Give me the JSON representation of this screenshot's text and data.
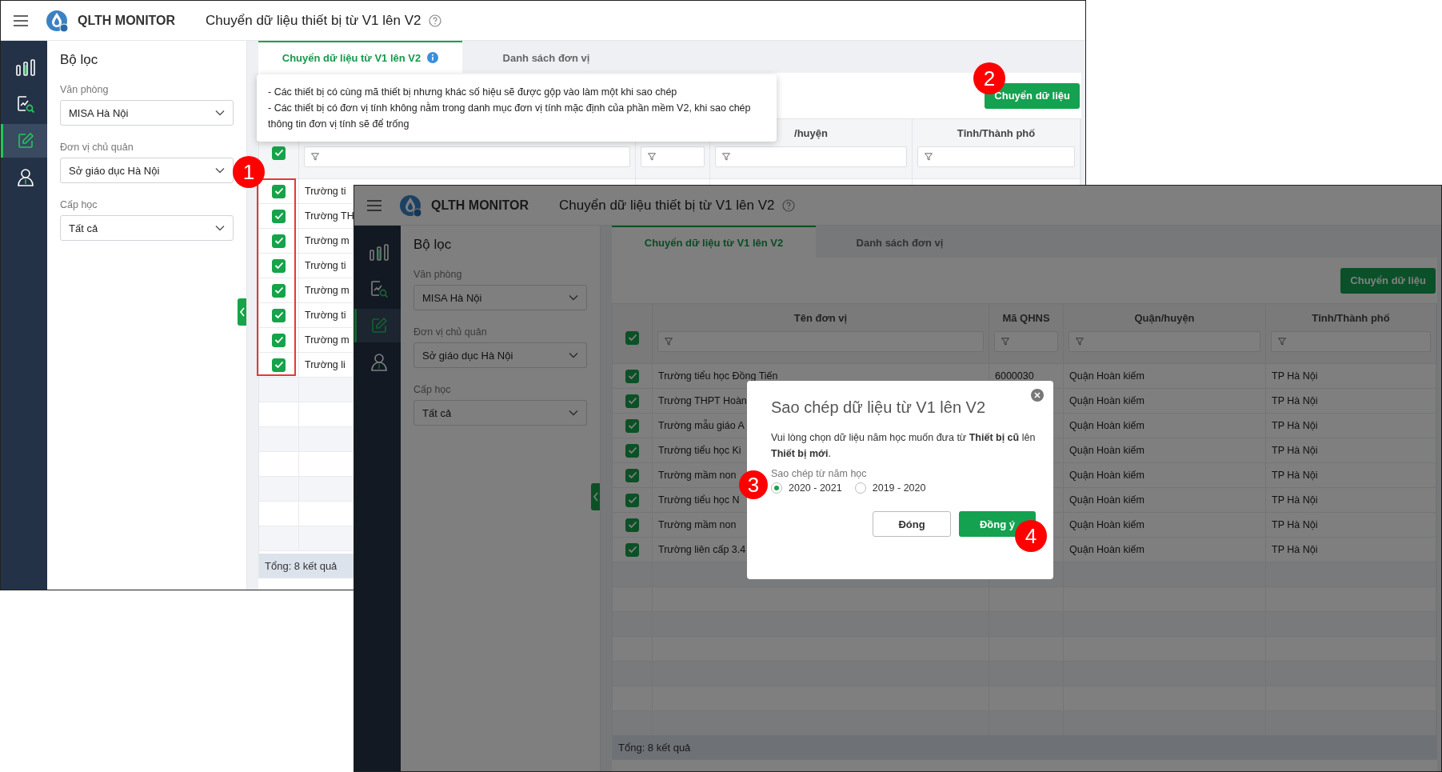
{
  "windows": [
    {
      "kind": "plain",
      "app_name": "QLTH MONITOR",
      "page_title": "Chuyển dữ liệu thiết bị từ V1 lên V2",
      "nav": [
        {
          "kind": "bars",
          "selected": false
        },
        {
          "kind": "report",
          "selected": false
        },
        {
          "kind": "edit",
          "selected": true
        },
        {
          "kind": "user",
          "selected": false
        }
      ],
      "filter": {
        "title": "Bộ lọc",
        "fields": [
          {
            "label": "Văn phòng",
            "value": "MISA Hà Nội"
          },
          {
            "label": "Đơn vị chủ quản",
            "value": "Sở giáo dục Hà Nội"
          },
          {
            "label": "Cấp học",
            "value": "Tất cả"
          }
        ]
      },
      "tabs": [
        {
          "label": "Chuyển dữ liệu từ V1 lên V2",
          "selected": true,
          "info_icon": true
        },
        {
          "label": "Danh sách đơn vị",
          "selected": false,
          "info_icon": false
        }
      ],
      "tooltip": [
        "- Các thiết bị có cùng mã thiết bị nhưng khác số hiệu sẽ được gộp vào làm một khi sao chép",
        "- Các thiết bị có đơn vị tính không nằm trong danh mục đơn vị tính mặc định của phần mềm V2, khi sao chép thông tin đơn vị tính sẽ để trống"
      ],
      "action_button": "Chuyển dữ liệu",
      "all_checked": true,
      "columns": [
        null,
        null,
        "/huyện",
        "Tỉnh/Thành phố"
      ],
      "rows": [
        {
          "checked": true,
          "cells": [
            "Trường ti"
          ]
        },
        {
          "checked": true,
          "cells": [
            "Trường TH"
          ]
        },
        {
          "checked": true,
          "cells": [
            "Trường m"
          ]
        },
        {
          "checked": true,
          "cells": [
            "Trường ti"
          ]
        },
        {
          "checked": true,
          "cells": [
            "Trường m"
          ]
        },
        {
          "checked": true,
          "cells": [
            "Trường ti"
          ]
        },
        {
          "checked": true,
          "cells": [
            "Trường m"
          ]
        },
        {
          "checked": true,
          "cells": [
            "Trường li"
          ]
        }
      ],
      "footer": "Tổng: 8 kết quả"
    },
    {
      "kind": "dimmed",
      "app_name": "QLTH MONITOR",
      "page_title": "Chuyển dữ liệu thiết bị từ V1 lên V2",
      "nav": [
        {
          "kind": "bars",
          "selected": false
        },
        {
          "kind": "report",
          "selected": false
        },
        {
          "kind": "edit",
          "selected": true
        },
        {
          "kind": "user",
          "selected": false
        }
      ],
      "filter": {
        "title": "Bộ lọc",
        "fields": [
          {
            "label": "Văn phòng",
            "value": "MISA Hà Nội"
          },
          {
            "label": "Đơn vị chủ quản",
            "value": "Sở giáo dục Hà Nội"
          },
          {
            "label": "Cấp học",
            "value": "Tất cả"
          }
        ]
      },
      "tabs": [
        {
          "label": "Chuyển dữ liệu từ V1 lên V2",
          "selected": true,
          "info_icon": false
        },
        {
          "label": "Danh sách đơn vị",
          "selected": false,
          "info_icon": false
        }
      ],
      "action_button": "Chuyển dữ liệu",
      "all_checked": true,
      "columns": [
        "Tên đơn vị",
        "Mã QHNS",
        "Quận/huyện",
        "Tỉnh/Thành phố"
      ],
      "rows": [
        {
          "checked": true,
          "cells": [
            "Trường tiểu học Đồng Tiến",
            "6000030",
            "Quận Hoàn kiếm",
            "TP Hà Nội"
          ]
        },
        {
          "checked": true,
          "cells": [
            "Trường THPT Hoàn",
            null,
            "Quận Hoàn kiếm",
            "TP Hà Nội"
          ]
        },
        {
          "checked": true,
          "cells": [
            "Trường mẫu giáo A",
            null,
            "Quận Hoàn kiếm",
            "TP Hà Nội"
          ]
        },
        {
          "checked": true,
          "cells": [
            "Trường tiểu học Ki",
            null,
            "Quận Hoàn kiếm",
            "TP Hà Nội"
          ]
        },
        {
          "checked": true,
          "cells": [
            "Trường mầm non",
            null,
            "Quận Hoàn kiếm",
            "TP Hà Nội"
          ]
        },
        {
          "checked": true,
          "cells": [
            "Trường tiểu học N",
            null,
            "Quận Hoàn kiếm",
            "TP Hà Nội"
          ]
        },
        {
          "checked": true,
          "cells": [
            "Trường mầm non",
            null,
            "Quận Hoàn kiếm",
            "TP Hà Nội"
          ]
        },
        {
          "checked": true,
          "cells": [
            "Trường liên cấp 3.4",
            null,
            "Quận Hoàn kiếm",
            "TP Hà Nội"
          ]
        }
      ],
      "footer": "Tổng: 8 kết quả",
      "dialog": {
        "title": "Sao chép dữ liệu từ V1 lên V2",
        "message": "Vui lòng chọn dữ liệu năm học muốn đưa từ **Thiết bị cũ** lên **Thiết bị mới**.",
        "field_label": "Sao chép từ năm học",
        "options": [
          {
            "label": "2020 - 2021",
            "selected": true
          },
          {
            "label": "2019 - 2020",
            "selected": false
          }
        ],
        "buttons": [
          {
            "kind": "secondary",
            "label": "Đóng"
          },
          {
            "kind": "primary",
            "label": "Đồng ý"
          }
        ]
      }
    }
  ],
  "annotations": [
    {
      "kind": "box"
    },
    {
      "kind": "marker",
      "number": "1"
    },
    {
      "kind": "marker",
      "number": "2"
    },
    {
      "kind": "marker",
      "number": "3"
    },
    {
      "kind": "marker",
      "number": "4"
    }
  ]
}
